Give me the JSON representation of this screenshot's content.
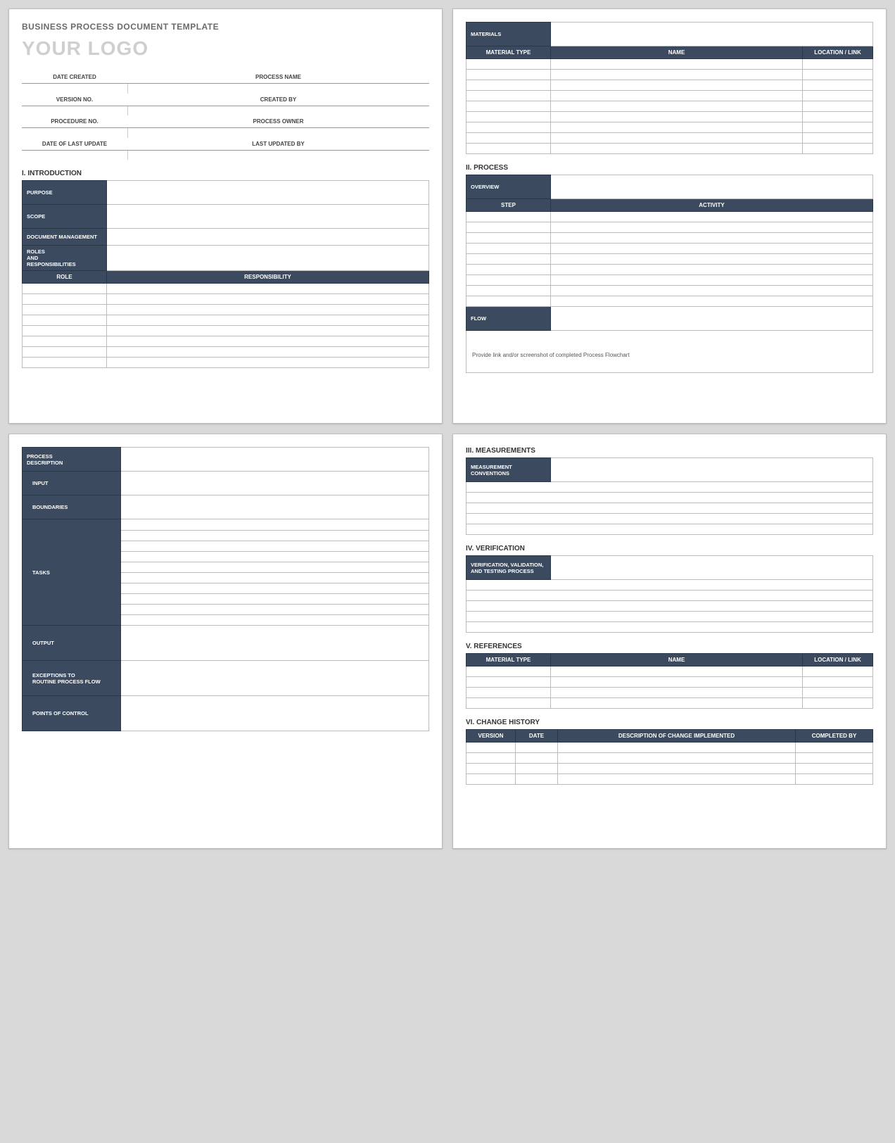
{
  "header": {
    "doc_title": "BUSINESS PROCESS DOCUMENT TEMPLATE",
    "logo": "YOUR LOGO",
    "meta": {
      "date_created": "DATE CREATED",
      "process_name": "PROCESS NAME",
      "version_no": "VERSION NO.",
      "created_by": "CREATED BY",
      "procedure_no": "PROCEDURE NO.",
      "process_owner": "PROCESS OWNER",
      "date_last_update": "DATE OF LAST UPDATE",
      "last_updated_by": "LAST UPDATED BY"
    }
  },
  "sections": {
    "introduction": {
      "heading": "I.   INTRODUCTION",
      "rows": {
        "purpose": "PURPOSE",
        "scope": "SCOPE",
        "document_management": "DOCUMENT MANAGEMENT",
        "roles_responsibilities": "ROLES\nAND\nRESPONSIBILITIES"
      },
      "role_header": "ROLE",
      "responsibility_header": "RESPONSIBILITY"
    },
    "materials": {
      "label": "MATERIALS",
      "head": {
        "type": "MATERIAL TYPE",
        "name": "NAME",
        "location": "LOCATION / LINK"
      }
    },
    "process": {
      "heading": "II.   PROCESS",
      "overview": "OVERVIEW",
      "step": "STEP",
      "activity": "ACTIVITY",
      "flow": "FLOW",
      "flow_note": "Provide link and/or screenshot of completed Process Flowchart"
    },
    "process_description": {
      "label": "PROCESS\nDESCRIPTION",
      "input": "INPUT",
      "boundaries": "BOUNDARIES",
      "tasks": "TASKS",
      "output": "OUTPUT",
      "exceptions": "EXCEPTIONS TO\nROUTINE PROCESS FLOW",
      "points_of_control": "POINTS OF CONTROL"
    },
    "measurements": {
      "heading": "III.  MEASUREMENTS",
      "label": "MEASUREMENT\nCONVENTIONS"
    },
    "verification": {
      "heading": "IV. VERIFICATION",
      "label": "VERIFICATION, VALIDATION,\nAND TESTING PROCESS"
    },
    "references": {
      "heading": "V.  REFERENCES",
      "head": {
        "type": "MATERIAL TYPE",
        "name": "NAME",
        "location": "LOCATION / LINK"
      }
    },
    "change_history": {
      "heading": "VI. CHANGE HISTORY",
      "head": {
        "version": "VERSION",
        "date": "DATE",
        "description": "DESCRIPTION OF CHANGE IMPLEMENTED",
        "completed_by": "COMPLETED BY"
      }
    }
  }
}
